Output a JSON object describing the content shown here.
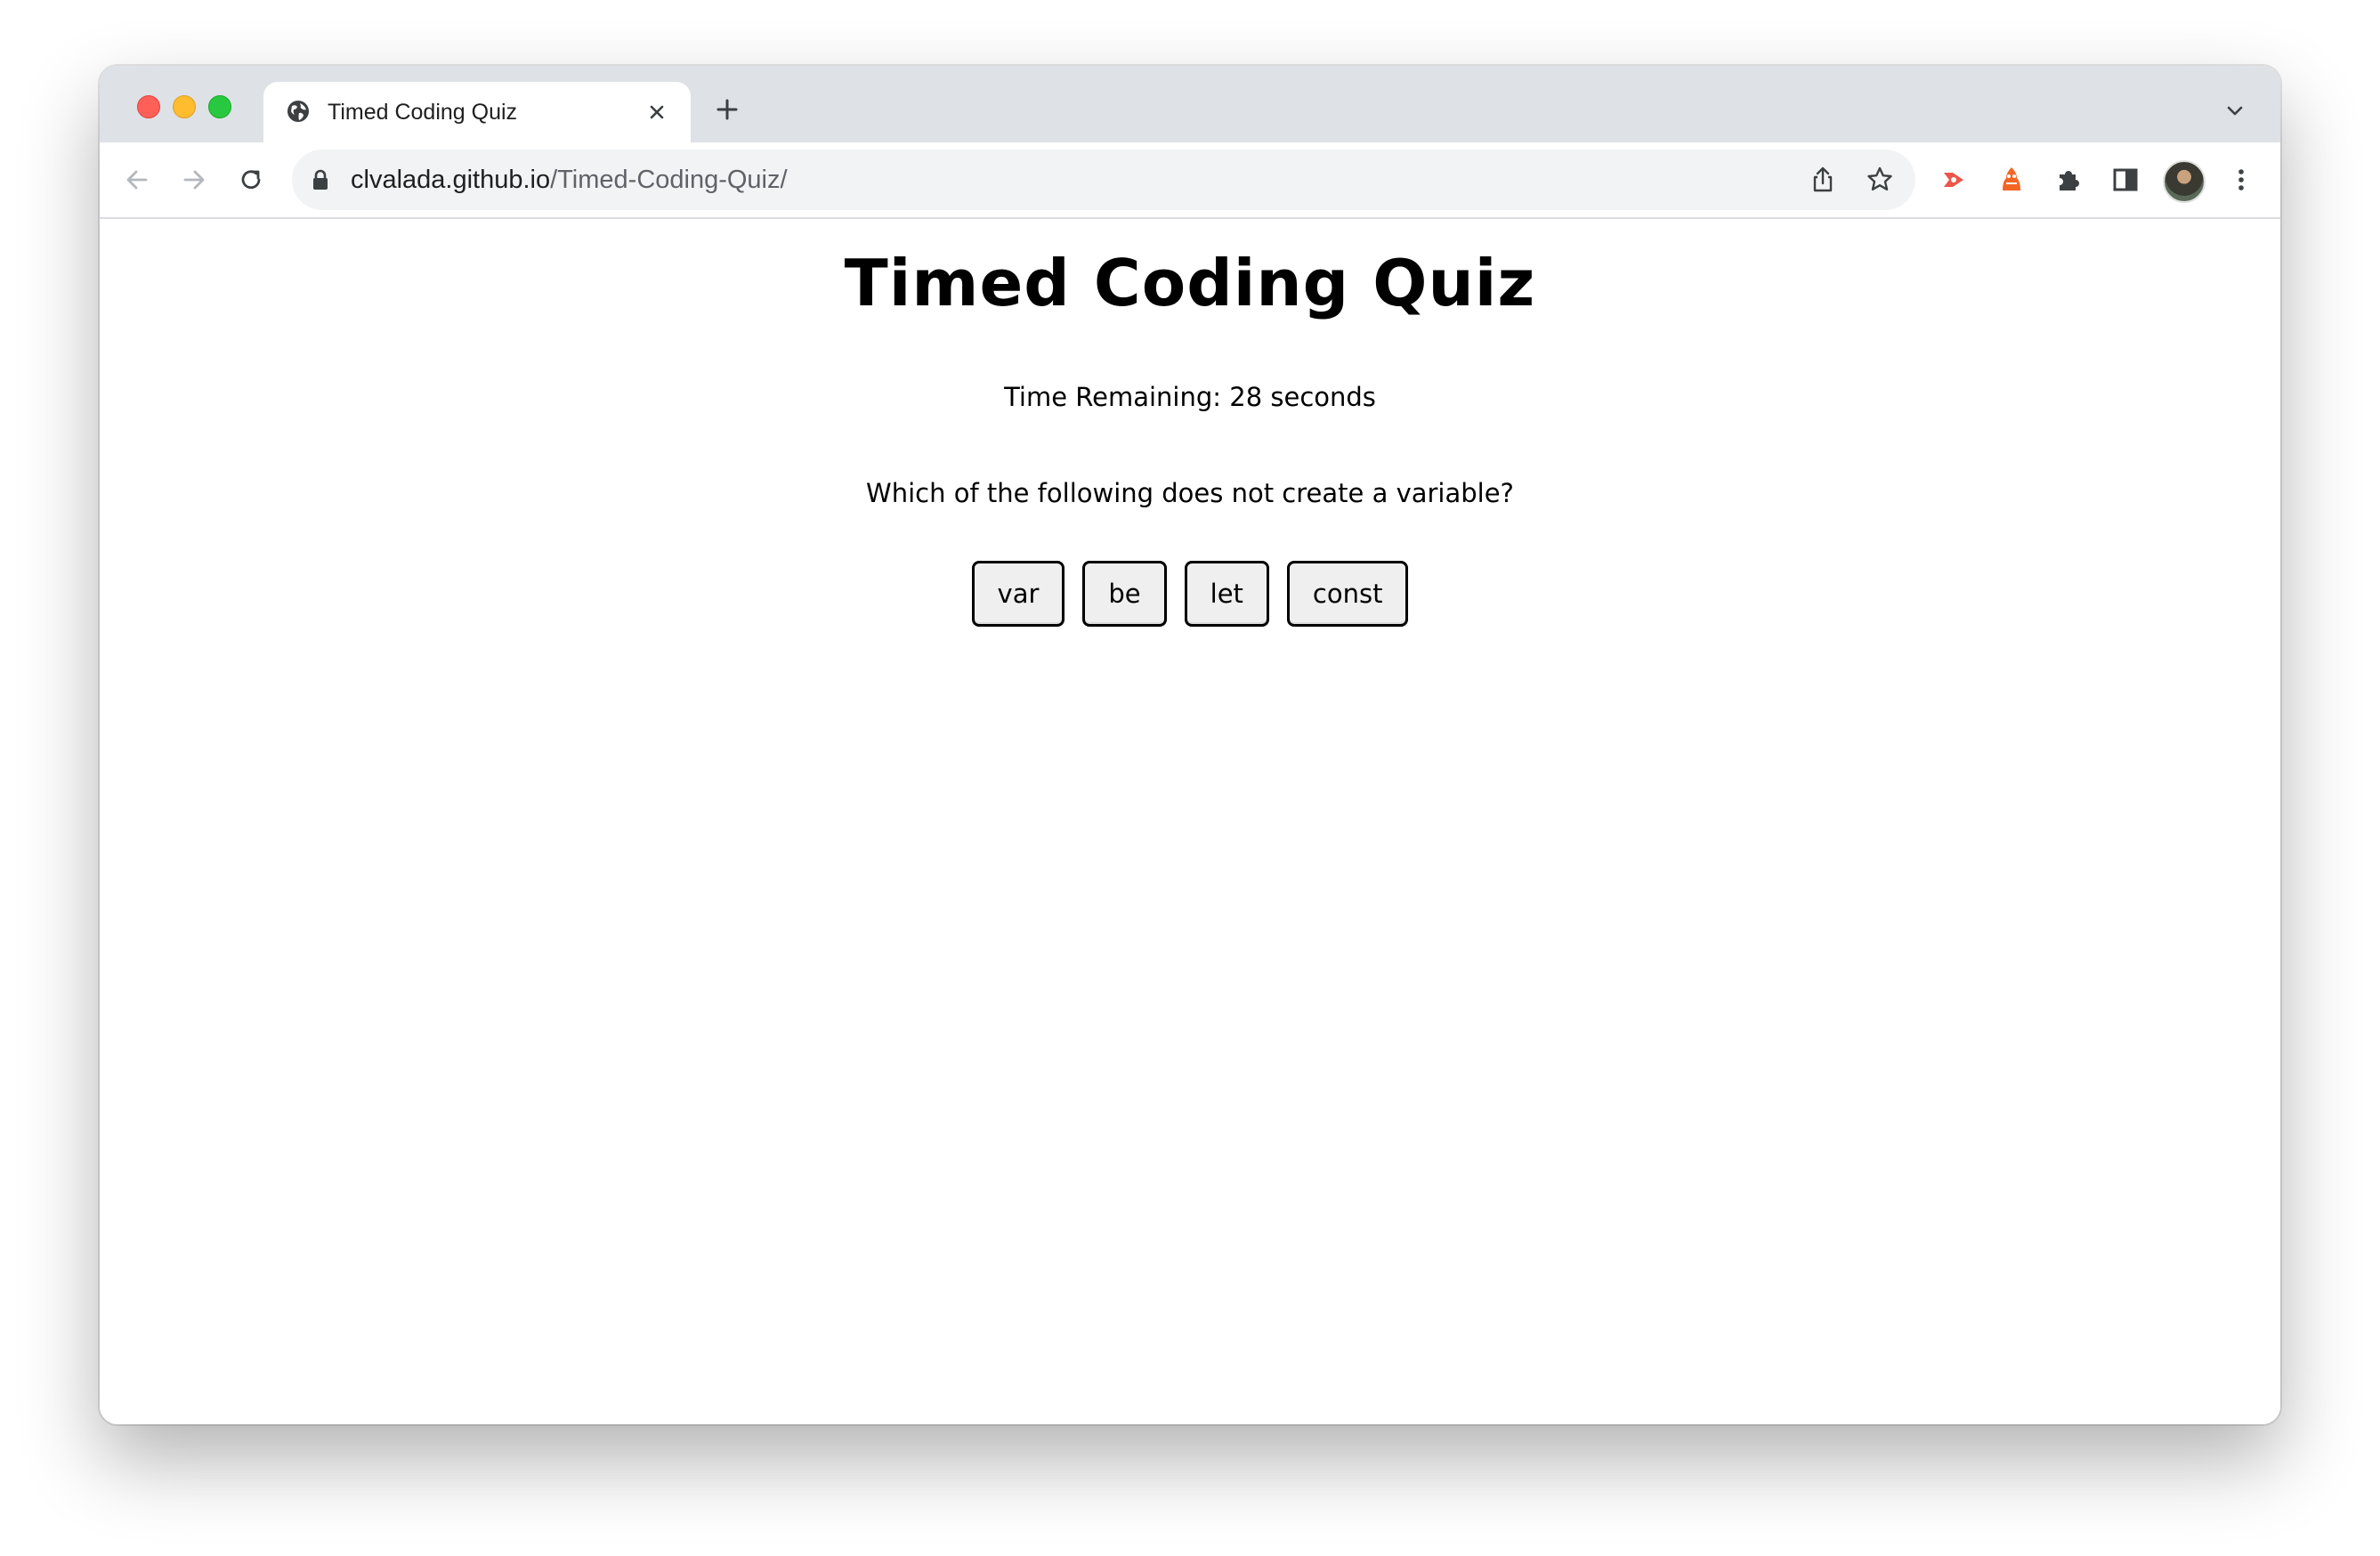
{
  "browser": {
    "tab": {
      "title": "Timed Coding Quiz",
      "icon": "globe-icon"
    },
    "address_bar": {
      "domain": "clvalada.github.io",
      "path": "/Timed-Coding-Quiz/"
    },
    "toolbar_icons": [
      "back-arrow-icon",
      "forward-arrow-icon",
      "reload-icon",
      "lock-icon",
      "share-icon",
      "bookmark-star-icon",
      "extension-record-icon",
      "extension-orange-icon",
      "extensions-puzzle-icon",
      "side-panel-icon",
      "profile-avatar",
      "menu-kebab-icon"
    ]
  },
  "page": {
    "title": "Timed Coding Quiz",
    "timer_text": "Time Remaining: 28 seconds",
    "question": "Which of the following does not create a variable?",
    "answers": [
      "var",
      "be",
      "let",
      "const"
    ]
  },
  "colors": {
    "tabstrip": "#dee1e6",
    "omnibox": "#f1f3f4",
    "close": "#fe5f57",
    "minimize": "#febc2e",
    "maximize": "#28c840",
    "extension_red": "#ea4335",
    "extension_orange": "#f46524"
  }
}
